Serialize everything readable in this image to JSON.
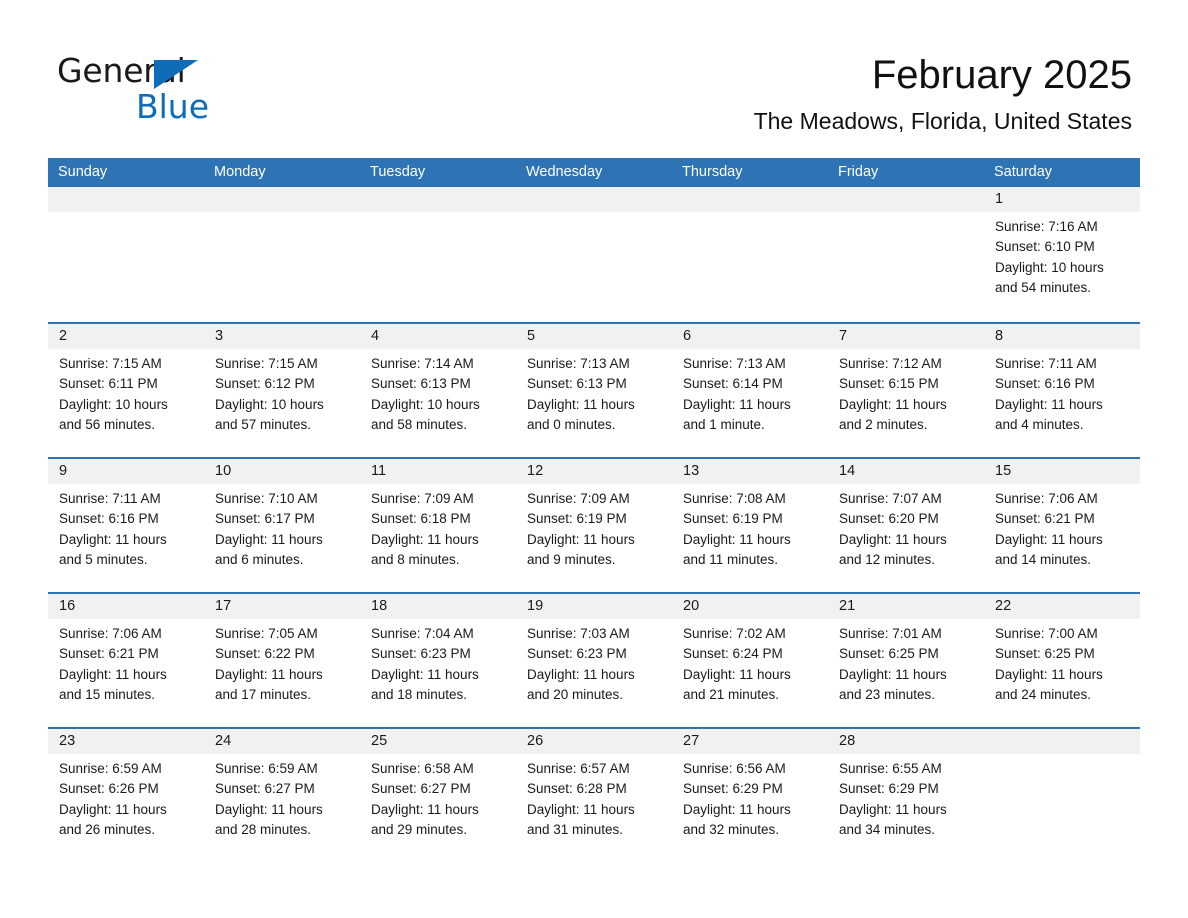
{
  "brand": {
    "name_part1": "General",
    "name_part2": "Blue",
    "triangle_color": "#0f6cb8",
    "text_color": "#1a1a1a"
  },
  "header": {
    "title": "February 2025",
    "subtitle": "The Meadows, Florida, United States",
    "header_bg_color": "#2e74b5",
    "row_accent_color": "#2e74b5",
    "day_band_bg_color": "#f1f1f1"
  },
  "weekdays": [
    "Sunday",
    "Monday",
    "Tuesday",
    "Wednesday",
    "Thursday",
    "Friday",
    "Saturday"
  ],
  "weeks": [
    {
      "days": [
        {
          "number": "",
          "sunrise": "",
          "sunset": "",
          "daylight_1": "",
          "daylight_2": ""
        },
        {
          "number": "",
          "sunrise": "",
          "sunset": "",
          "daylight_1": "",
          "daylight_2": ""
        },
        {
          "number": "",
          "sunrise": "",
          "sunset": "",
          "daylight_1": "",
          "daylight_2": ""
        },
        {
          "number": "",
          "sunrise": "",
          "sunset": "",
          "daylight_1": "",
          "daylight_2": ""
        },
        {
          "number": "",
          "sunrise": "",
          "sunset": "",
          "daylight_1": "",
          "daylight_2": ""
        },
        {
          "number": "",
          "sunrise": "",
          "sunset": "",
          "daylight_1": "",
          "daylight_2": ""
        },
        {
          "number": "1",
          "sunrise": "Sunrise: 7:16 AM",
          "sunset": "Sunset: 6:10 PM",
          "daylight_1": "Daylight: 10 hours",
          "daylight_2": "and 54 minutes."
        }
      ]
    },
    {
      "days": [
        {
          "number": "2",
          "sunrise": "Sunrise: 7:15 AM",
          "sunset": "Sunset: 6:11 PM",
          "daylight_1": "Daylight: 10 hours",
          "daylight_2": "and 56 minutes."
        },
        {
          "number": "3",
          "sunrise": "Sunrise: 7:15 AM",
          "sunset": "Sunset: 6:12 PM",
          "daylight_1": "Daylight: 10 hours",
          "daylight_2": "and 57 minutes."
        },
        {
          "number": "4",
          "sunrise": "Sunrise: 7:14 AM",
          "sunset": "Sunset: 6:13 PM",
          "daylight_1": "Daylight: 10 hours",
          "daylight_2": "and 58 minutes."
        },
        {
          "number": "5",
          "sunrise": "Sunrise: 7:13 AM",
          "sunset": "Sunset: 6:13 PM",
          "daylight_1": "Daylight: 11 hours",
          "daylight_2": "and 0 minutes."
        },
        {
          "number": "6",
          "sunrise": "Sunrise: 7:13 AM",
          "sunset": "Sunset: 6:14 PM",
          "daylight_1": "Daylight: 11 hours",
          "daylight_2": "and 1 minute."
        },
        {
          "number": "7",
          "sunrise": "Sunrise: 7:12 AM",
          "sunset": "Sunset: 6:15 PM",
          "daylight_1": "Daylight: 11 hours",
          "daylight_2": "and 2 minutes."
        },
        {
          "number": "8",
          "sunrise": "Sunrise: 7:11 AM",
          "sunset": "Sunset: 6:16 PM",
          "daylight_1": "Daylight: 11 hours",
          "daylight_2": "and 4 minutes."
        }
      ]
    },
    {
      "days": [
        {
          "number": "9",
          "sunrise": "Sunrise: 7:11 AM",
          "sunset": "Sunset: 6:16 PM",
          "daylight_1": "Daylight: 11 hours",
          "daylight_2": "and 5 minutes."
        },
        {
          "number": "10",
          "sunrise": "Sunrise: 7:10 AM",
          "sunset": "Sunset: 6:17 PM",
          "daylight_1": "Daylight: 11 hours",
          "daylight_2": "and 6 minutes."
        },
        {
          "number": "11",
          "sunrise": "Sunrise: 7:09 AM",
          "sunset": "Sunset: 6:18 PM",
          "daylight_1": "Daylight: 11 hours",
          "daylight_2": "and 8 minutes."
        },
        {
          "number": "12",
          "sunrise": "Sunrise: 7:09 AM",
          "sunset": "Sunset: 6:19 PM",
          "daylight_1": "Daylight: 11 hours",
          "daylight_2": "and 9 minutes."
        },
        {
          "number": "13",
          "sunrise": "Sunrise: 7:08 AM",
          "sunset": "Sunset: 6:19 PM",
          "daylight_1": "Daylight: 11 hours",
          "daylight_2": "and 11 minutes."
        },
        {
          "number": "14",
          "sunrise": "Sunrise: 7:07 AM",
          "sunset": "Sunset: 6:20 PM",
          "daylight_1": "Daylight: 11 hours",
          "daylight_2": "and 12 minutes."
        },
        {
          "number": "15",
          "sunrise": "Sunrise: 7:06 AM",
          "sunset": "Sunset: 6:21 PM",
          "daylight_1": "Daylight: 11 hours",
          "daylight_2": "and 14 minutes."
        }
      ]
    },
    {
      "days": [
        {
          "number": "16",
          "sunrise": "Sunrise: 7:06 AM",
          "sunset": "Sunset: 6:21 PM",
          "daylight_1": "Daylight: 11 hours",
          "daylight_2": "and 15 minutes."
        },
        {
          "number": "17",
          "sunrise": "Sunrise: 7:05 AM",
          "sunset": "Sunset: 6:22 PM",
          "daylight_1": "Daylight: 11 hours",
          "daylight_2": "and 17 minutes."
        },
        {
          "number": "18",
          "sunrise": "Sunrise: 7:04 AM",
          "sunset": "Sunset: 6:23 PM",
          "daylight_1": "Daylight: 11 hours",
          "daylight_2": "and 18 minutes."
        },
        {
          "number": "19",
          "sunrise": "Sunrise: 7:03 AM",
          "sunset": "Sunset: 6:23 PM",
          "daylight_1": "Daylight: 11 hours",
          "daylight_2": "and 20 minutes."
        },
        {
          "number": "20",
          "sunrise": "Sunrise: 7:02 AM",
          "sunset": "Sunset: 6:24 PM",
          "daylight_1": "Daylight: 11 hours",
          "daylight_2": "and 21 minutes."
        },
        {
          "number": "21",
          "sunrise": "Sunrise: 7:01 AM",
          "sunset": "Sunset: 6:25 PM",
          "daylight_1": "Daylight: 11 hours",
          "daylight_2": "and 23 minutes."
        },
        {
          "number": "22",
          "sunrise": "Sunrise: 7:00 AM",
          "sunset": "Sunset: 6:25 PM",
          "daylight_1": "Daylight: 11 hours",
          "daylight_2": "and 24 minutes."
        }
      ]
    },
    {
      "days": [
        {
          "number": "23",
          "sunrise": "Sunrise: 6:59 AM",
          "sunset": "Sunset: 6:26 PM",
          "daylight_1": "Daylight: 11 hours",
          "daylight_2": "and 26 minutes."
        },
        {
          "number": "24",
          "sunrise": "Sunrise: 6:59 AM",
          "sunset": "Sunset: 6:27 PM",
          "daylight_1": "Daylight: 11 hours",
          "daylight_2": "and 28 minutes."
        },
        {
          "number": "25",
          "sunrise": "Sunrise: 6:58 AM",
          "sunset": "Sunset: 6:27 PM",
          "daylight_1": "Daylight: 11 hours",
          "daylight_2": "and 29 minutes."
        },
        {
          "number": "26",
          "sunrise": "Sunrise: 6:57 AM",
          "sunset": "Sunset: 6:28 PM",
          "daylight_1": "Daylight: 11 hours",
          "daylight_2": "and 31 minutes."
        },
        {
          "number": "27",
          "sunrise": "Sunrise: 6:56 AM",
          "sunset": "Sunset: 6:29 PM",
          "daylight_1": "Daylight: 11 hours",
          "daylight_2": "and 32 minutes."
        },
        {
          "number": "28",
          "sunrise": "Sunrise: 6:55 AM",
          "sunset": "Sunset: 6:29 PM",
          "daylight_1": "Daylight: 11 hours",
          "daylight_2": "and 34 minutes."
        },
        {
          "number": "",
          "sunrise": "",
          "sunset": "",
          "daylight_1": "",
          "daylight_2": ""
        }
      ]
    }
  ]
}
